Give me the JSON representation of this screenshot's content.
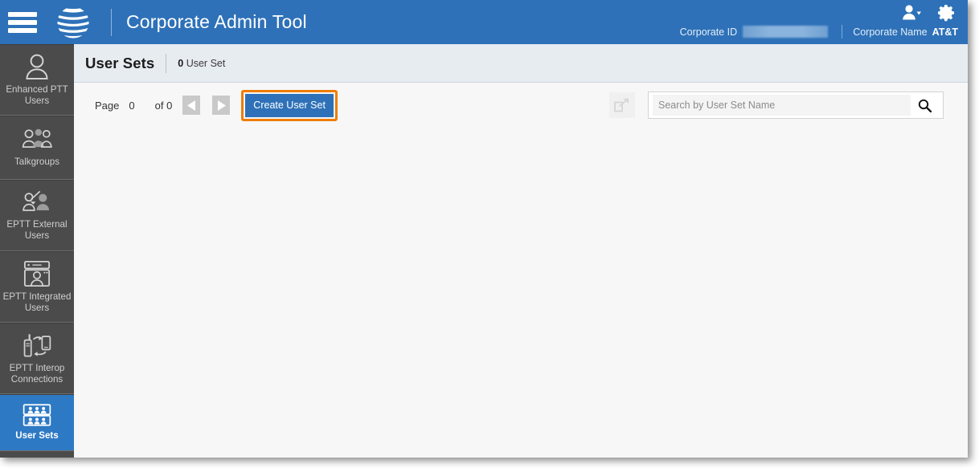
{
  "header": {
    "menu_icon": "hamburger-icon",
    "brand_icon": "att-globe-logo",
    "title": "Corporate Admin Tool",
    "user_icon": "user-dropdown-icon",
    "settings_icon": "gear-icon",
    "corporate_id_label": "Corporate ID",
    "corporate_id_value": "",
    "corporate_name_label": "Corporate Name",
    "corporate_name_value": "AT&T",
    "accent_color": "#2e71b8"
  },
  "sidebar": {
    "items": [
      {
        "label": "Enhanced PTT Users",
        "icon": "single-user-icon",
        "active": false
      },
      {
        "label": "Talkgroups",
        "icon": "user-group-icon",
        "active": false
      },
      {
        "label": "EPTT External Users",
        "icon": "external-user-icon",
        "active": false
      },
      {
        "label": "EPTT Integrated Users",
        "icon": "integrated-user-icon",
        "active": false
      },
      {
        "label": "EPTT Interop Connections",
        "icon": "interop-connection-icon",
        "active": false
      },
      {
        "label": "User Sets",
        "icon": "user-sets-icon",
        "active": true
      }
    ],
    "background_color": "#4b4b4b",
    "active_color": "#2e79c4"
  },
  "page": {
    "title": "User Sets",
    "count_number": "0",
    "count_label": "User Set"
  },
  "toolbar": {
    "page_label": "Page",
    "page_value": "0",
    "of_label": "of 0",
    "prev_icon": "previous-page-icon",
    "next_icon": "next-page-icon",
    "create_label": "Create User Set",
    "create_highlight_color": "#ef7d00",
    "export_icon": "export-icon",
    "search_placeholder": "Search by User Set Name",
    "search_value": "",
    "search_icon": "search-icon"
  }
}
